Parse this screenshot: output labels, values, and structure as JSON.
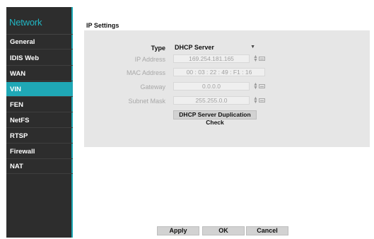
{
  "sidebar": {
    "title": "Network",
    "items": [
      {
        "label": "General"
      },
      {
        "label": "IDIS Web"
      },
      {
        "label": "WAN"
      },
      {
        "label": "VIN"
      },
      {
        "label": "FEN"
      },
      {
        "label": "NetFS"
      },
      {
        "label": "RTSP"
      },
      {
        "label": "Firewall"
      },
      {
        "label": "NAT"
      }
    ],
    "active_index": 3,
    "accent_color": "#1fa8b6"
  },
  "main": {
    "section_title": "IP Settings",
    "type": {
      "label": "Type",
      "value": "DHCP Server"
    },
    "ip_address": {
      "label": "IP Address",
      "value": "169.254.181.165"
    },
    "mac_address": {
      "label": "MAC Address",
      "value": "00 : 03 : 22 : 49 : F1 : 16"
    },
    "gateway": {
      "label": "Gateway",
      "value": "0.0.0.0"
    },
    "subnet_mask": {
      "label": "Subnet Mask",
      "value": "255.255.0.0"
    },
    "dup_check_label": "DHCP Server Duplication Check"
  },
  "footer": {
    "apply_label": "Apply",
    "ok_label": "OK",
    "cancel_label": "Cancel"
  }
}
